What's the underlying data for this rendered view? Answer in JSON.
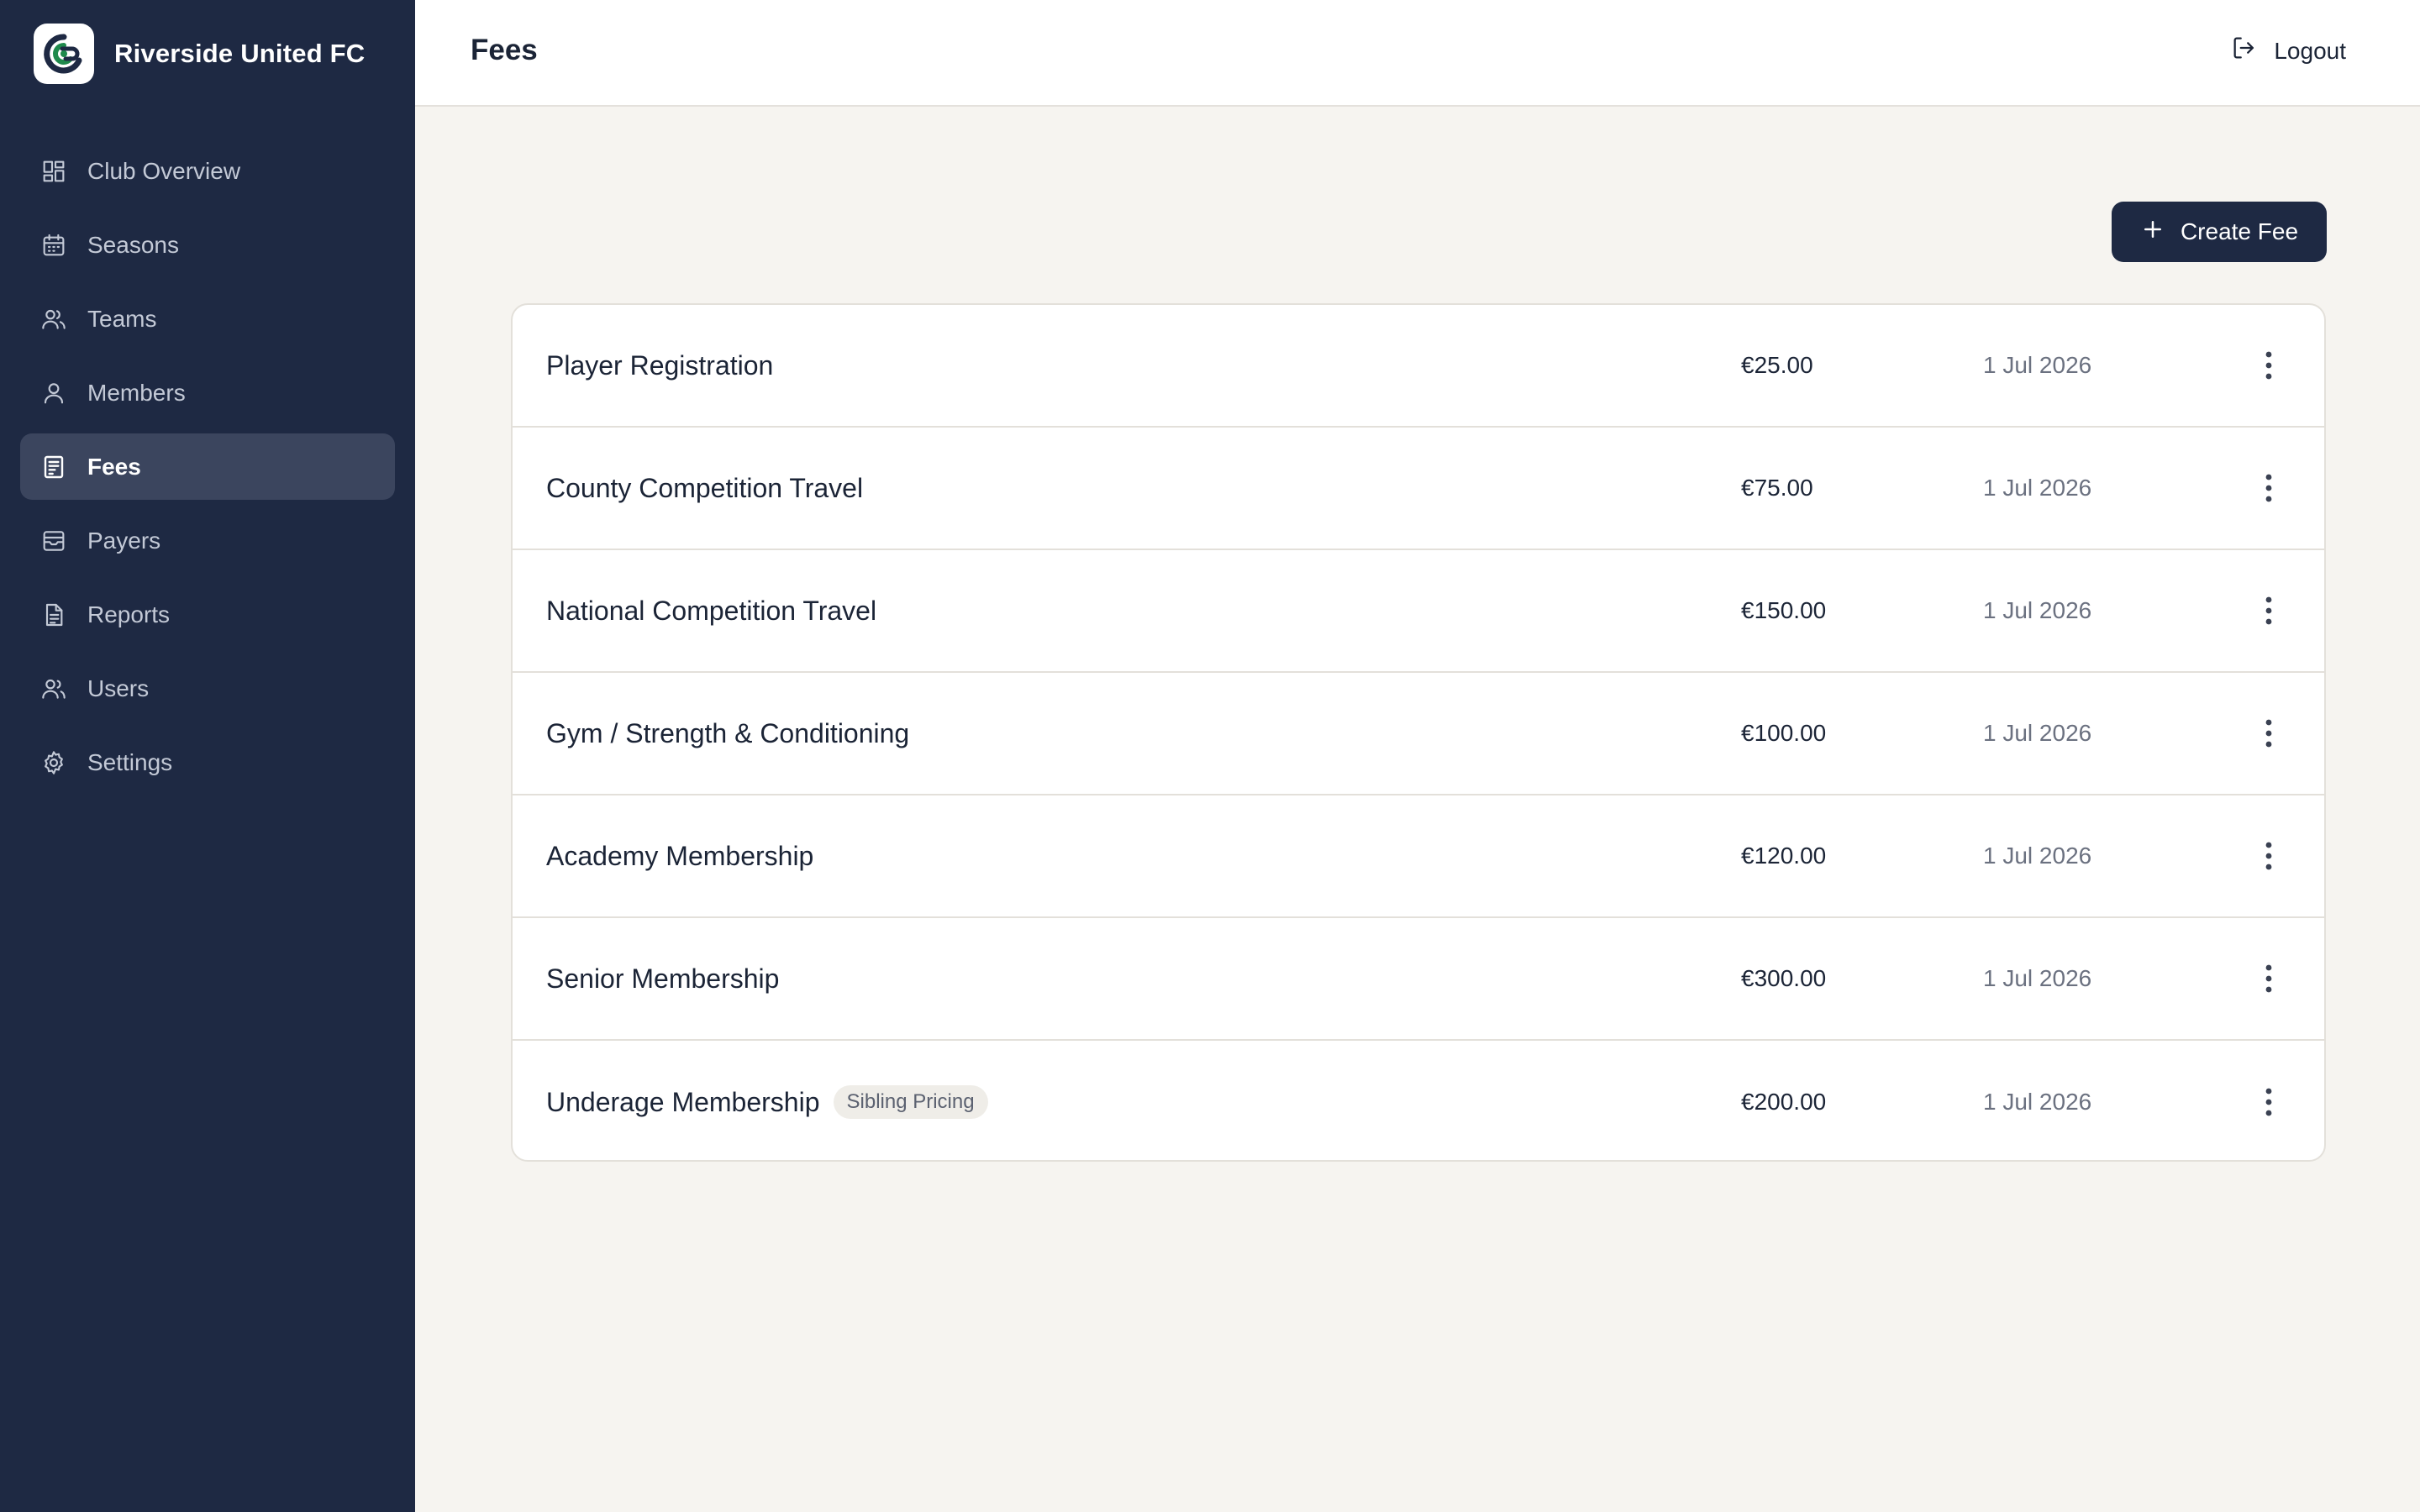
{
  "brand": {
    "name": "Riverside United FC",
    "logo_icon": "club-crest-icon"
  },
  "sidebar": {
    "items": [
      {
        "label": "Club Overview",
        "icon": "dashboard-grid-icon",
        "active": false
      },
      {
        "label": "Seasons",
        "icon": "calendar-icon",
        "active": false
      },
      {
        "label": "Teams",
        "icon": "users-group-icon",
        "active": false
      },
      {
        "label": "Members",
        "icon": "user-icon",
        "active": false
      },
      {
        "label": "Fees",
        "icon": "receipt-icon",
        "active": true
      },
      {
        "label": "Payers",
        "icon": "inbox-icon",
        "active": false
      },
      {
        "label": "Reports",
        "icon": "document-icon",
        "active": false
      },
      {
        "label": "Users",
        "icon": "users-icon",
        "active": false
      },
      {
        "label": "Settings",
        "icon": "gear-icon",
        "active": false
      }
    ]
  },
  "header": {
    "title": "Fees",
    "logout_label": "Logout"
  },
  "actions": {
    "create_label": "Create Fee"
  },
  "fees": [
    {
      "name": "Player Registration",
      "amount": "€25.00",
      "date": "1 Jul 2026",
      "badge": ""
    },
    {
      "name": "County Competition Travel",
      "amount": "€75.00",
      "date": "1 Jul 2026",
      "badge": ""
    },
    {
      "name": "National Competition Travel",
      "amount": "€150.00",
      "date": "1 Jul 2026",
      "badge": ""
    },
    {
      "name": "Gym / Strength & Conditioning",
      "amount": "€100.00",
      "date": "1 Jul 2026",
      "badge": ""
    },
    {
      "name": "Academy Membership",
      "amount": "€120.00",
      "date": "1 Jul 2026",
      "badge": ""
    },
    {
      "name": "Senior Membership",
      "amount": "€300.00",
      "date": "1 Jul 2026",
      "badge": ""
    },
    {
      "name": "Underage Membership",
      "amount": "€200.00",
      "date": "1 Jul 2026",
      "badge": "Sibling Pricing"
    }
  ],
  "colors": {
    "sidebar_bg": "#1e2943",
    "sidebar_active_bg": "#3b455e",
    "page_bg": "#f6f4f0",
    "primary_button": "#1e2943",
    "logo_accent": "#1f8a4c"
  }
}
